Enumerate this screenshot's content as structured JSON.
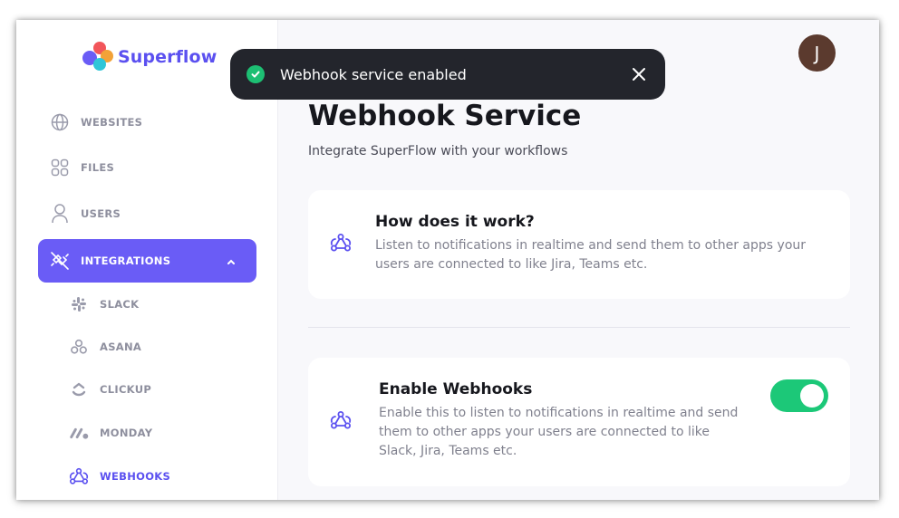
{
  "brand": {
    "name": "Superflow"
  },
  "sidebar": {
    "items": [
      {
        "label": "WEBSITES",
        "icon": "globe-icon"
      },
      {
        "label": "FILES",
        "icon": "grid-icon"
      },
      {
        "label": "USERS",
        "icon": "user-icon"
      },
      {
        "label": "INTEGRATIONS",
        "icon": "integrations-icon",
        "active": true,
        "expanded": true
      }
    ],
    "sub_items": [
      {
        "label": "SLACK",
        "icon": "slack-icon"
      },
      {
        "label": "ASANA",
        "icon": "asana-icon"
      },
      {
        "label": "CLICKUP",
        "icon": "clickup-icon"
      },
      {
        "label": "MONDAY",
        "icon": "monday-icon"
      },
      {
        "label": "WEBHOOKS",
        "icon": "webhook-icon",
        "current": true
      }
    ]
  },
  "user": {
    "avatar_initial": "J"
  },
  "toast": {
    "message": "Webhook service enabled"
  },
  "page": {
    "title": "Webhook Service",
    "subtitle": "Integrate SuperFlow with your workflows"
  },
  "cards": {
    "how": {
      "title": "How does it work?",
      "line1": "Listen to notifications in realtime and send them to other apps your",
      "line2": "users are connected to like Jira, Teams etc."
    },
    "enable": {
      "title": "Enable Webhooks",
      "line1": "Enable this to listen to notifications in realtime and send",
      "line2": "them to other apps your users are connected to like",
      "line3": "Slack, Jira, Teams etc.",
      "enabled": true
    }
  },
  "colors": {
    "accent": "#6a5cf6",
    "brand_text": "#5b50f0",
    "toggle_on": "#1cc878",
    "toast_bg": "#23252c",
    "success": "#1dbf73"
  }
}
